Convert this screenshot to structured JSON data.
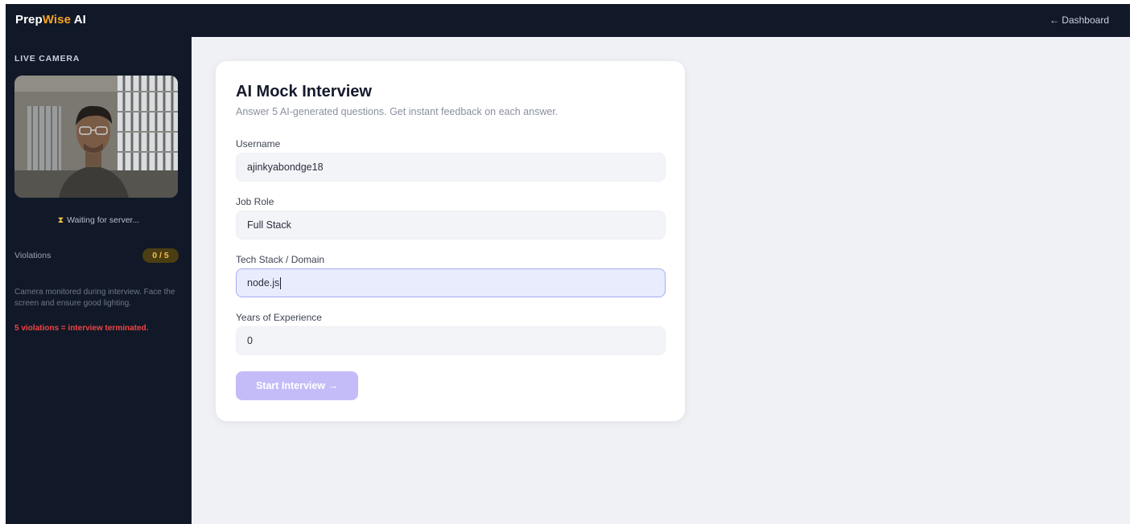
{
  "header": {
    "brand_prefix": "Prep",
    "brand_accent": "Wise",
    "brand_suffix": " AI",
    "dashboard_link": "← Dashboard"
  },
  "sidebar": {
    "camera_title": "LIVE CAMERA",
    "camera_feed": "webcam-feed-image",
    "status_icon": "hourglass-icon",
    "status_text": "Waiting for server...",
    "violations_label": "Violations",
    "violations_count": "0 / 5",
    "note": "Camera monitored during interview. Face the screen and ensure good lighting.",
    "warning": "5 violations = interview terminated."
  },
  "form": {
    "title": "AI Mock Interview",
    "subtitle": "Answer 5 AI-generated questions. Get instant feedback on each answer.",
    "username_label": "Username",
    "username_value": "ajinkyabondge18",
    "job_role_label": "Job Role",
    "job_role_value": "Full Stack",
    "tech_stack_label": "Tech Stack / Domain",
    "tech_stack_value": "node.js",
    "experience_label": "Years of Experience",
    "experience_value": "0",
    "start_button": "Start Interview →"
  },
  "colors": {
    "header_bg": "#111827",
    "brand_accent": "#f5a524",
    "page_bg": "#f0f1f5",
    "warning": "#ef4444",
    "button_disabled": "#c4bcf8"
  }
}
